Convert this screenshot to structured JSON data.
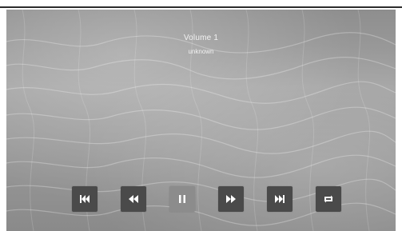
{
  "now_playing": {
    "title": "Volume 1",
    "artist": "unknown"
  },
  "controls": [
    {
      "id": "skip-previous",
      "icon": "skip-previous-icon"
    },
    {
      "id": "rewind",
      "icon": "rewind-icon"
    },
    {
      "id": "pause",
      "icon": "pause-icon"
    },
    {
      "id": "fast-forward",
      "icon": "fast-forward-icon"
    },
    {
      "id": "skip-next",
      "icon": "skip-next-icon"
    },
    {
      "id": "repeat",
      "icon": "repeat-icon"
    }
  ],
  "colors": {
    "button_bg": "#4a4a4a",
    "pause_button_bg": "#8c8c8c",
    "text": "#f2f2f2",
    "top_rule": "#2c2c2c"
  }
}
